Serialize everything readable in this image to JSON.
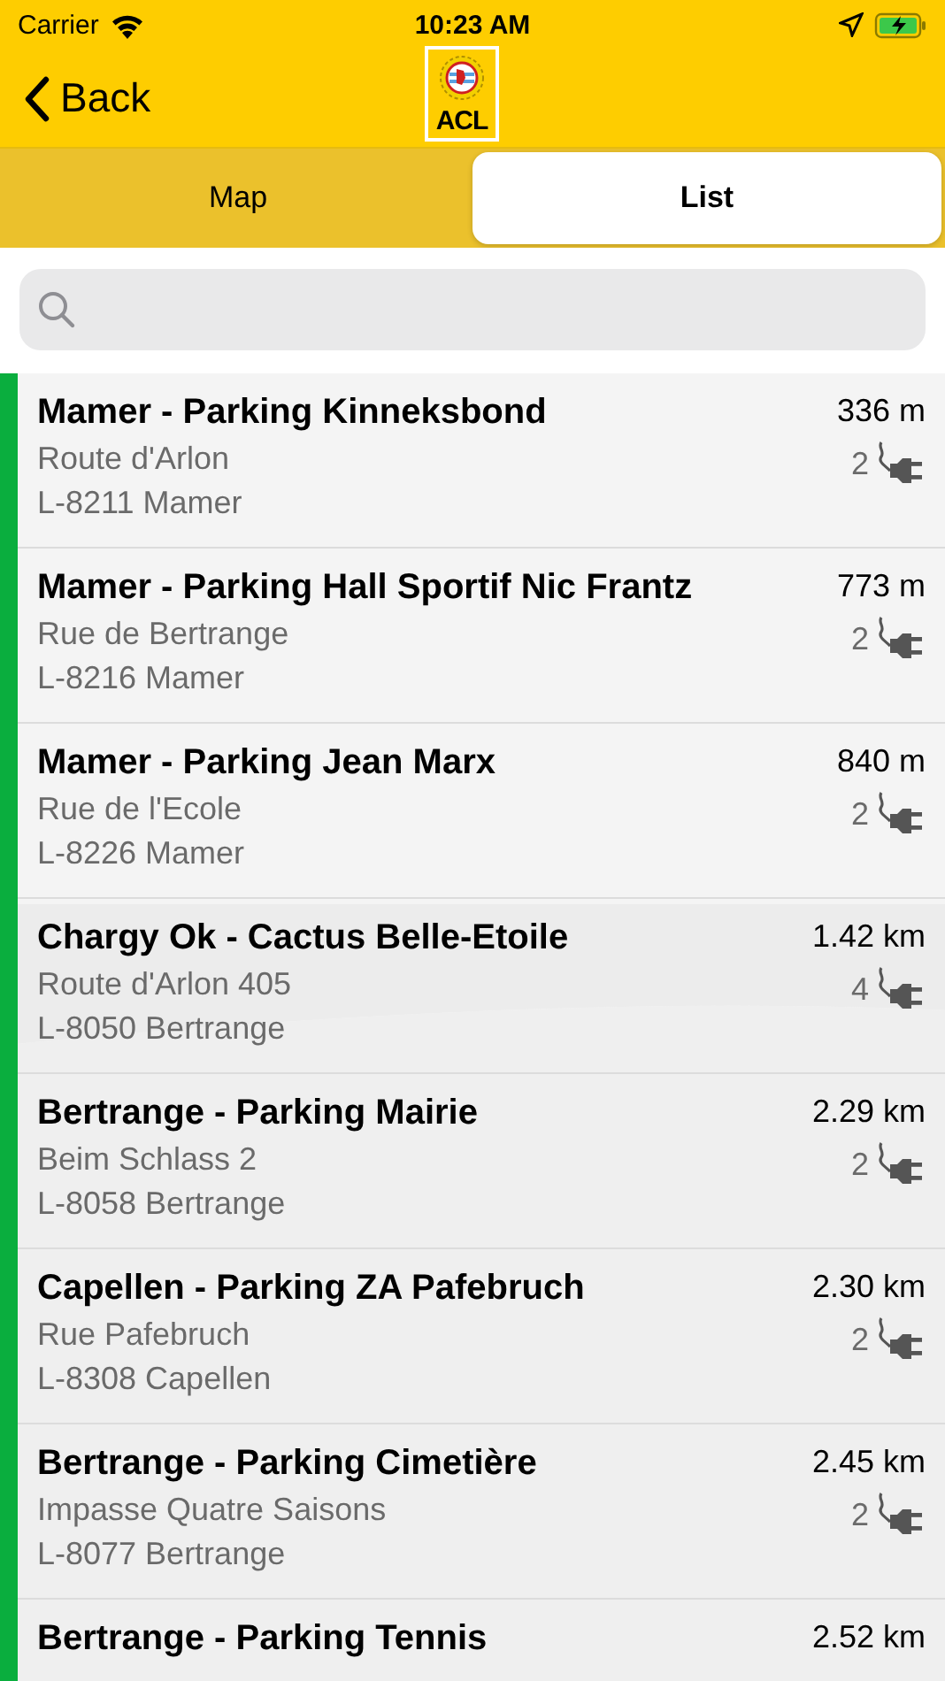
{
  "status_bar": {
    "carrier": "Carrier",
    "time": "10:23 AM"
  },
  "nav": {
    "back": "Back",
    "logo_text": "ACL"
  },
  "tabs": [
    {
      "label": "Map",
      "selected": false
    },
    {
      "label": "List",
      "selected": true
    }
  ],
  "stations": [
    {
      "name": "Mamer - Parking Kinneksbond",
      "street": "Route d'Arlon",
      "city": "L-8211 Mamer",
      "distance": "336 m",
      "plugs": "2",
      "color": "#0aae3e"
    },
    {
      "name": "Mamer - Parking Hall Sportif Nic Frantz",
      "street": "Rue de Bertrange",
      "city": "L-8216 Mamer",
      "distance": "773 m",
      "plugs": "2",
      "color": "#0aae3e"
    },
    {
      "name": "Mamer - Parking Jean Marx",
      "street": "Rue de l'Ecole",
      "city": "L-8226 Mamer",
      "distance": "840 m",
      "plugs": "2",
      "color": "#0aae3e"
    },
    {
      "name": "Chargy Ok - Cactus Belle-Etoile",
      "street": "Route d'Arlon 405",
      "city": "L-8050 Bertrange",
      "distance": "1.42 km",
      "plugs": "4",
      "color": "#0aae3e"
    },
    {
      "name": "Bertrange - Parking Mairie",
      "street": "Beim Schlass 2",
      "city": "L-8058 Bertrange",
      "distance": "2.29 km",
      "plugs": "2",
      "color": "#0aae3e"
    },
    {
      "name": "Capellen - Parking ZA Pafebruch",
      "street": "Rue Pafebruch",
      "city": "L-8308 Capellen",
      "distance": "2.30 km",
      "plugs": "2",
      "color": "#0aae3e"
    },
    {
      "name": "Bertrange - Parking Cimetière",
      "street": "Impasse Quatre Saisons",
      "city": "L-8077 Bertrange",
      "distance": "2.45 km",
      "plugs": "2",
      "color": "#0aae3e"
    },
    {
      "name": "Bertrange - Parking Tennis",
      "distance": "2.52 km",
      "color": "#0aae3e"
    }
  ]
}
